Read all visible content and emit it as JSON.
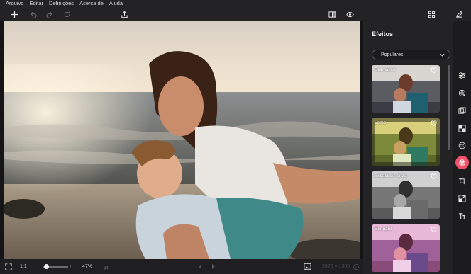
{
  "menu": {
    "file": "Arquivo",
    "edit": "Editar",
    "settings": "Definições",
    "about": "Acerca de",
    "help": "Ajuda"
  },
  "toolbar": {
    "icons": [
      "add-icon",
      "undo-icon",
      "redo-icon",
      "reset-icon",
      "share-icon",
      "compare-icon",
      "preview-eye-icon",
      "grid-icon",
      "edit-pen-icon"
    ]
  },
  "bottombar": {
    "ratio_label": "1:1",
    "zoom_minus": "−",
    "zoom_plus": "+",
    "zoom_value": "47%",
    "zoom_fraction": 0.47,
    "dimensions": "2076 × 1389"
  },
  "panel": {
    "title": "Efeitos",
    "filter_selected": "Populares",
    "effects": [
      {
        "label": "Dramático"
      },
      {
        "label": "Lomo"
      },
      {
        "label": "Escala de cinza"
      },
      {
        "label": "Bonnard"
      }
    ]
  },
  "rail": {
    "icons": [
      "adjustments-icon",
      "retouch-icon",
      "overlay-icon",
      "texture-icon",
      "face-icon",
      "effects-icon",
      "crop-icon",
      "resize-icon",
      "text-icon"
    ]
  },
  "colors": {
    "accent": "#f2536a",
    "panel_bg": "#232326",
    "app_bg": "#1c1c1e"
  }
}
